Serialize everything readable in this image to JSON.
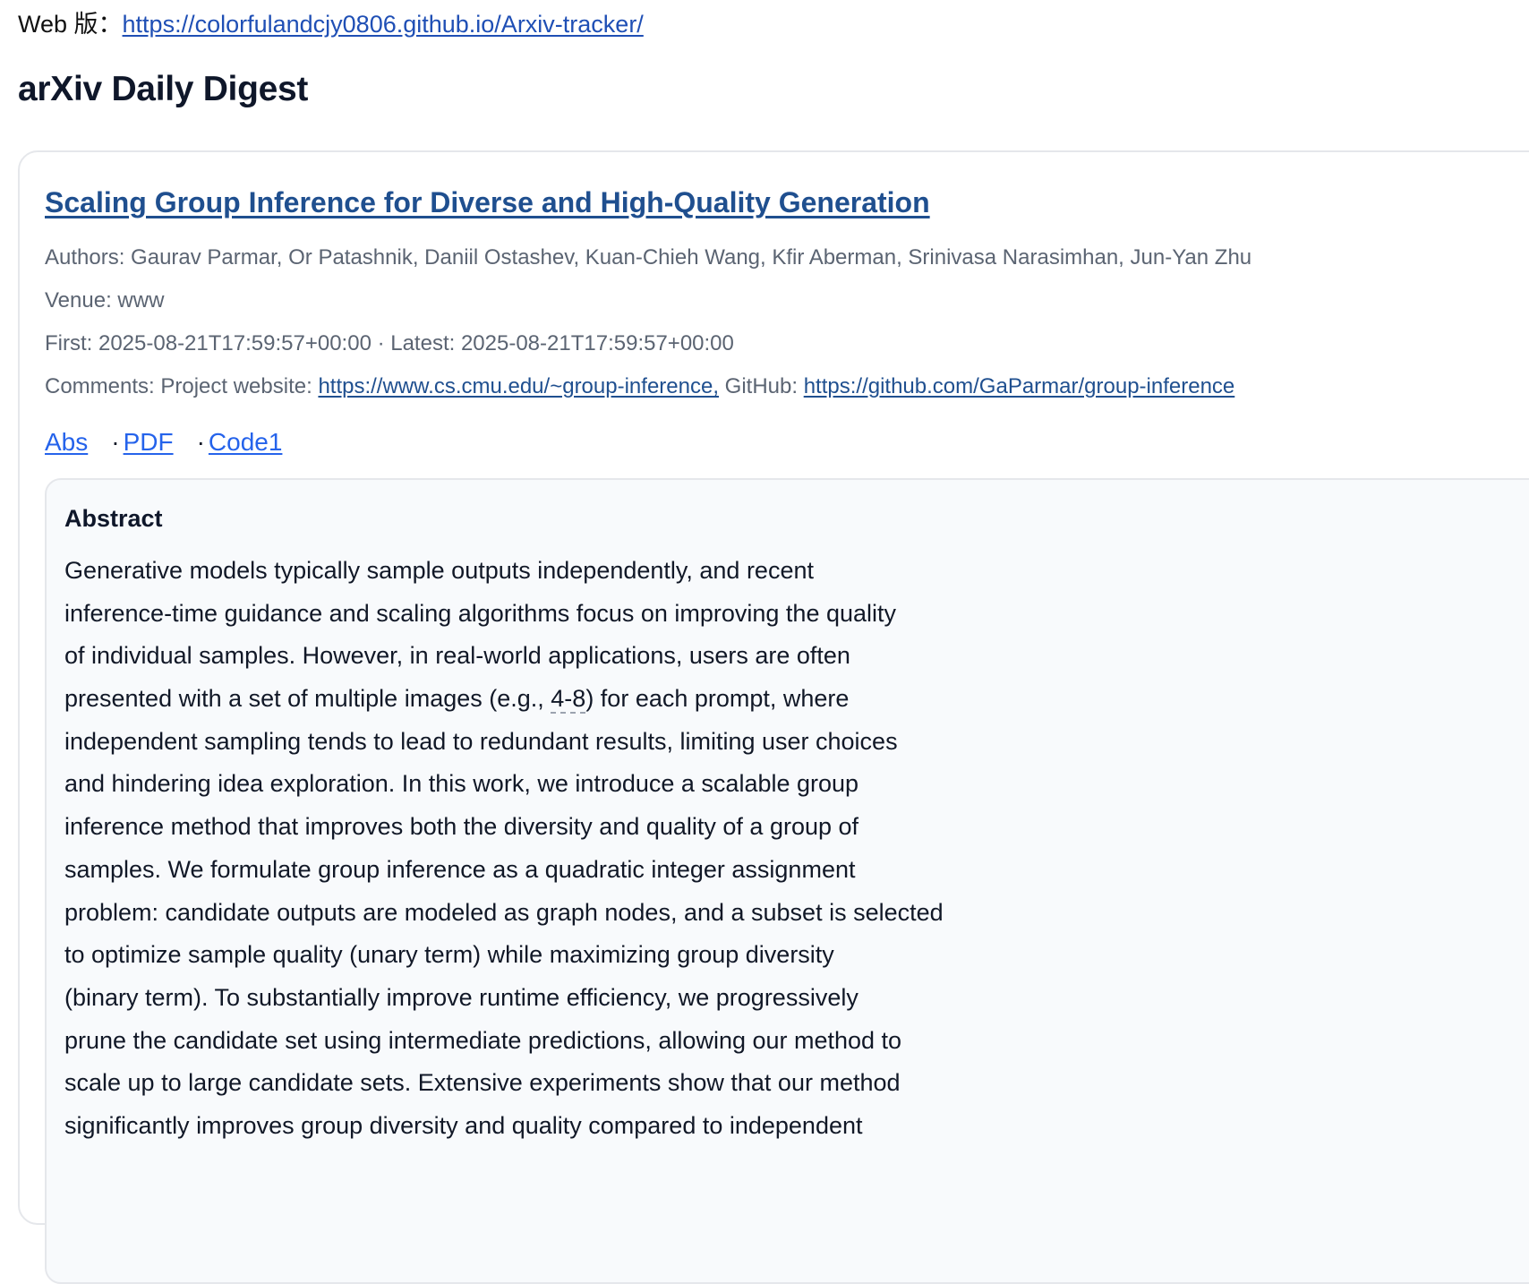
{
  "web": {
    "label": "Web 版：",
    "url": "https://colorfulandcjy0806.github.io/Arxiv-tracker/"
  },
  "page_title": "arXiv Daily Digest",
  "paper": {
    "title": "Scaling Group Inference for Diverse and High-Quality Generation",
    "authors": "Authors: Gaurav Parmar, Or Patashnik, Daniil Ostashev, Kuan-Chieh Wang, Kfir Aberman, Srinivasa Narasimhan, Jun-Yan Zhu",
    "venue": "Venue: www",
    "dates": "First: 2025-08-21T17:59:57+00:00 · Latest: 2025-08-21T17:59:57+00:00",
    "comments_prefix": "Comments: Project website: ",
    "project_url": "https://www.cs.cmu.edu/~group-inference,",
    "github_prefix": " GitHub: ",
    "github_url": "https://github.com/GaParmar/group-inference",
    "links": {
      "abs": "Abs",
      "sep1": "·",
      "pdf": "PDF",
      "sep2": "·",
      "code": "Code1"
    },
    "abstract_heading": "Abstract",
    "abstract_lines": [
      "Generative models typically sample outputs independently, and recent",
      "inference-time guidance and scaling algorithms focus on improving the quality",
      "of individual samples. However, in real-world applications, users are often",
      {
        "before": "presented with a set of multiple images (e.g., ",
        "mark": "4-8",
        "after": ") for each prompt, where"
      },
      "independent sampling tends to lead to redundant results, limiting user choices",
      "and hindering idea exploration. In this work, we introduce a scalable group",
      "inference method that improves both the diversity and quality of a group of",
      "samples. We formulate group inference as a quadratic integer assignment",
      "problem: candidate outputs are modeled as graph nodes, and a subset is selected",
      "to optimize sample quality (unary term) while maximizing group diversity",
      "(binary term). To substantially improve runtime efficiency, we progressively",
      "prune the candidate set using intermediate predictions, allowing our method to",
      "scale up to large candidate sets. Extensive experiments show that our method",
      "significantly improves group diversity and quality compared to independent"
    ]
  }
}
